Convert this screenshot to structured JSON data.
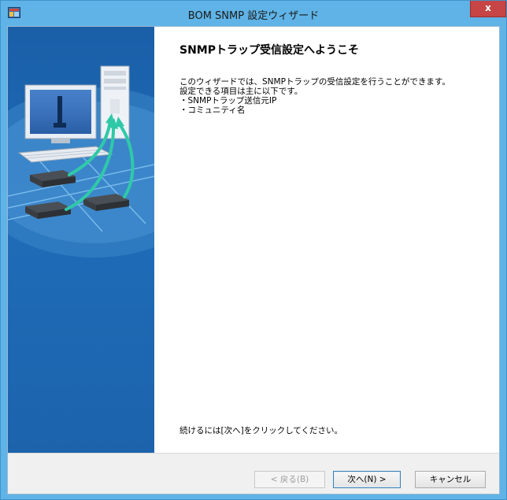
{
  "window": {
    "title": "BOM SNMP 設定ウィザード",
    "close_label": "x"
  },
  "content": {
    "heading": "SNMPトラップ受信設定へようこそ",
    "lines": [
      "このウィザードでは、SNMPトラップの受信設定を行うことができます。",
      "設定できる項目は主に以下です。",
      "・SNMPトラップ送信元IP",
      "・コミュニティ名"
    ],
    "footer_hint": "続けるには[次へ]をクリックしてください。"
  },
  "buttons": {
    "back_label": "< 戻る(B)",
    "next_label": "次へ(N) >",
    "cancel_label": "キャンセル"
  },
  "colors": {
    "titlebar": "#5fb3e6",
    "close_button": "#c74545",
    "side_panel": "#1f6cb8",
    "arrow_accent": "#2fc9a8"
  },
  "icons": {
    "app": "wizard-app-icon",
    "illustration": "network-computer-illustration"
  }
}
